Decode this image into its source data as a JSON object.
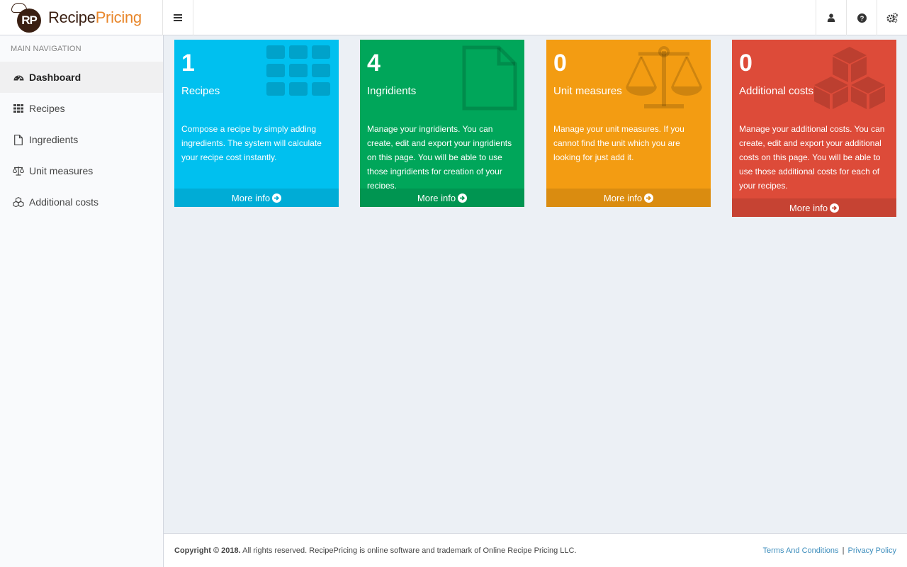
{
  "brand": {
    "logo_initials": "RP",
    "name_part1": "Recipe",
    "name_part2": "Pricing"
  },
  "header": {
    "toggle_icon": "bars-icon",
    "right_icons": [
      "user-icon",
      "question-circle-icon",
      "cogs-icon"
    ]
  },
  "sidebar": {
    "header": "MAIN NAVIGATION",
    "items": [
      {
        "label": "Dashboard",
        "icon": "dashboard-icon",
        "active": true
      },
      {
        "label": "Recipes",
        "icon": "grid-icon",
        "active": false
      },
      {
        "label": "Ingredients",
        "icon": "file-icon",
        "active": false
      },
      {
        "label": "Unit measures",
        "icon": "balance-scale-icon",
        "active": false
      },
      {
        "label": "Additional costs",
        "icon": "cubes-icon",
        "active": false
      }
    ]
  },
  "boxes": [
    {
      "count": "1",
      "title": "Recipes",
      "description": "Compose a recipe by simply adding ingredients. The system will calculate your recipe cost instantly.",
      "link": "More info",
      "icon": "grid-icon",
      "color": "#00c0ef"
    },
    {
      "count": "4",
      "title": "Ingridients",
      "description": "Manage your ingridients. You can create, edit and export your ingridients on this page. You will be able to use those ingridients for creation of your recipes.",
      "link": "More info",
      "icon": "file-icon",
      "color": "#00a65a"
    },
    {
      "count": "0",
      "title": "Unit measures",
      "description": "Manage your unit measures. If you cannot find the unit which you are looking for just add it.",
      "link": "More info",
      "icon": "balance-scale-icon",
      "color": "#f39c12"
    },
    {
      "count": "0",
      "title": "Additional costs",
      "description": "Manage your additional costs. You can create, edit and export your additional costs on this page. You will be able to use those additional costs for each of your recipes.",
      "link": "More info",
      "icon": "cubes-icon",
      "color": "#dd4b39"
    }
  ],
  "footer": {
    "copyright_bold": "Copyright © 2018.",
    "copyright_rest": " All rights reserved. RecipePricing is online software and trademark of Online Recipe Pricing LLC.",
    "terms": "Terms And Conditions",
    "separator": "|",
    "privacy": "Privacy Policy"
  }
}
